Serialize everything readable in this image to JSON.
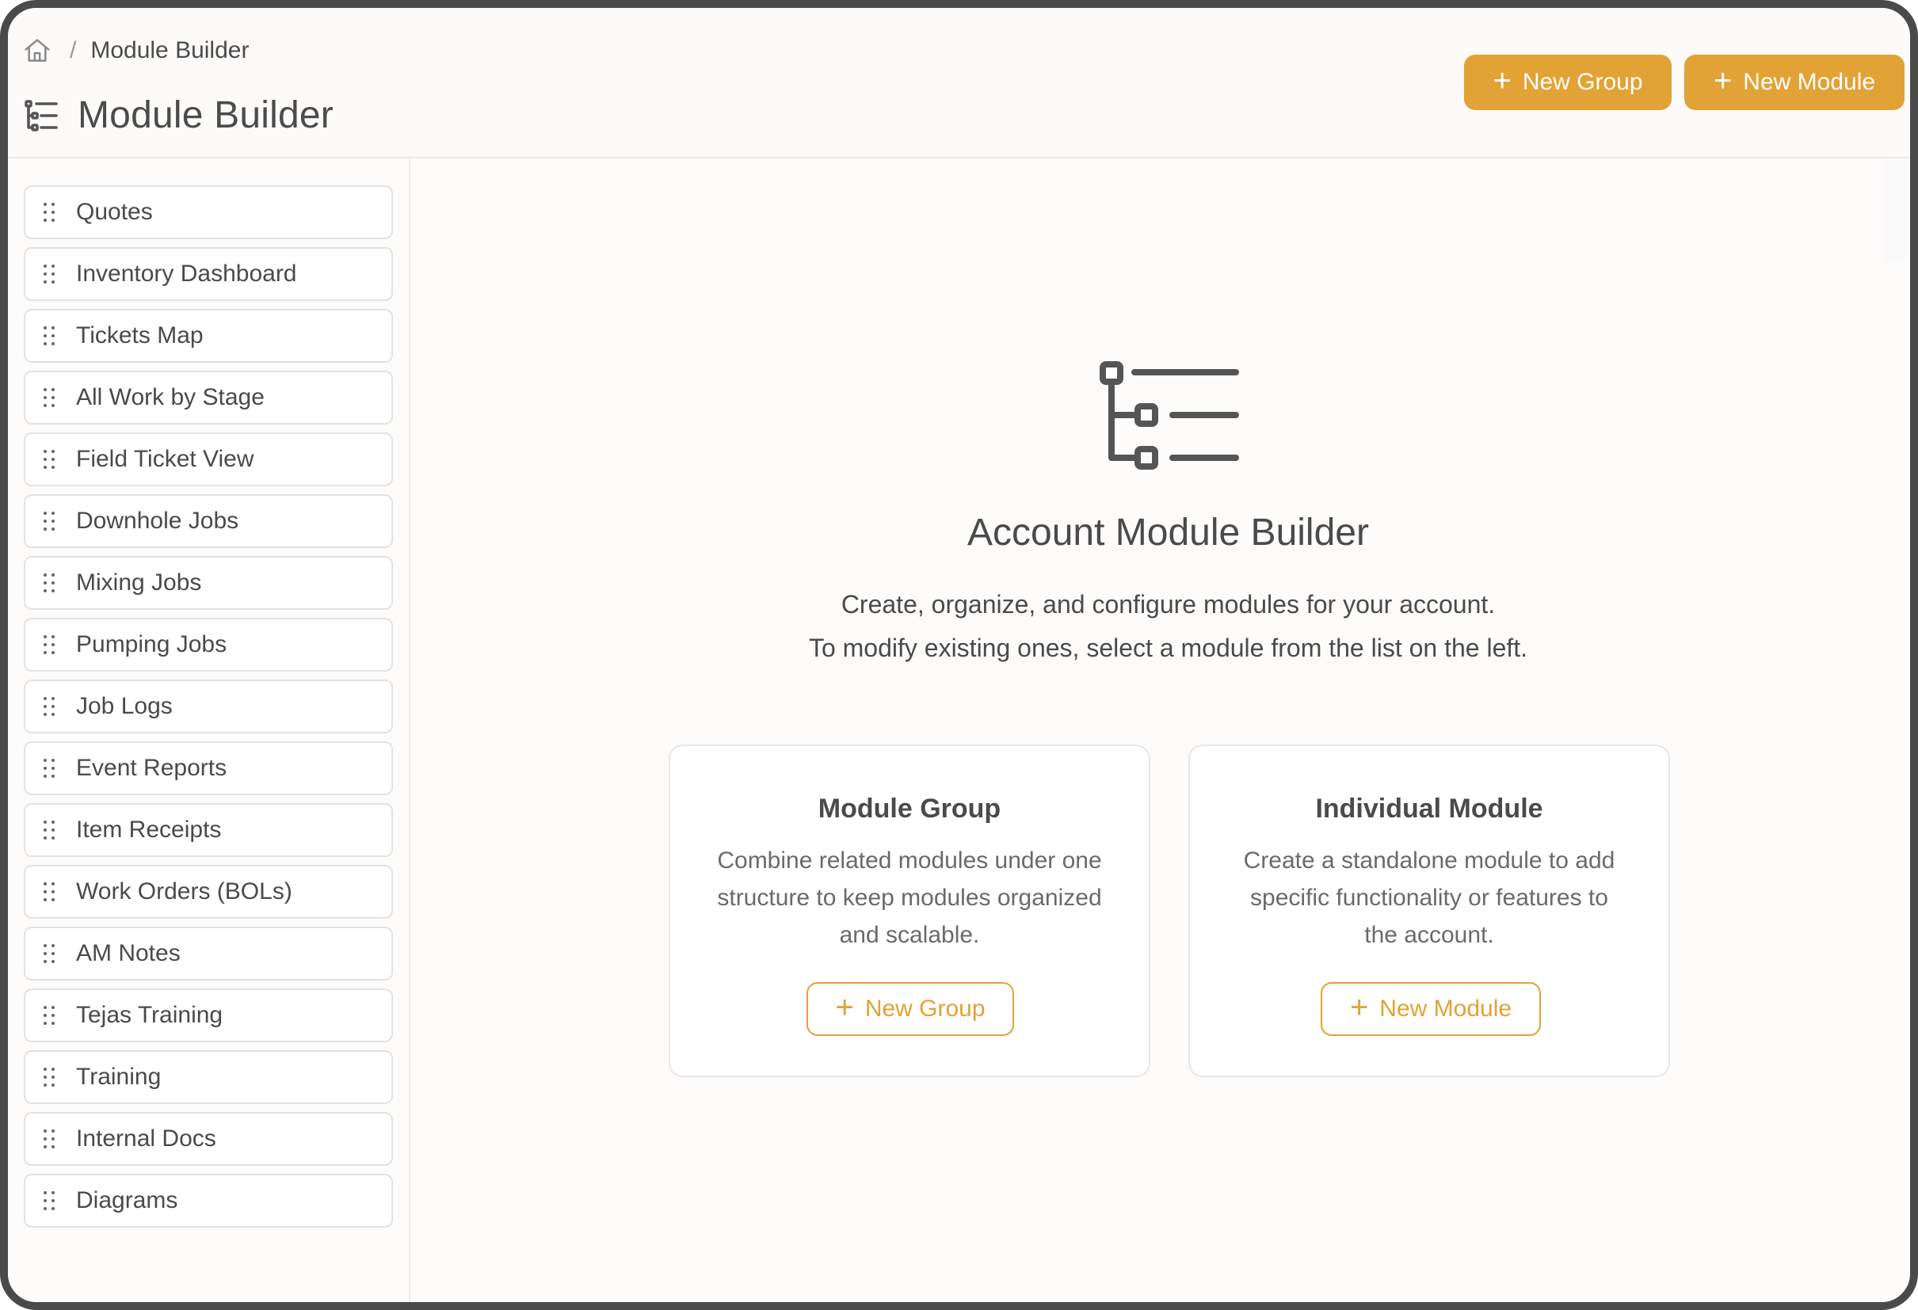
{
  "breadcrumb": {
    "home_icon": "home-icon",
    "separator": "/",
    "current": "Module Builder"
  },
  "header": {
    "title": "Module Builder",
    "title_icon": "module-tree-icon",
    "new_group_label": "New Group",
    "new_module_label": "New Module"
  },
  "colors": {
    "accent": "#e3a235",
    "text": "#4a4a4a",
    "muted": "#6a6a6a",
    "border": "#e3e3e3"
  },
  "sidebar": {
    "items": [
      {
        "label": "Quotes"
      },
      {
        "label": "Inventory Dashboard"
      },
      {
        "label": "Tickets Map"
      },
      {
        "label": "All Work by Stage"
      },
      {
        "label": "Field Ticket View"
      },
      {
        "label": "Downhole Jobs"
      },
      {
        "label": "Mixing Jobs"
      },
      {
        "label": "Pumping Jobs"
      },
      {
        "label": "Job Logs"
      },
      {
        "label": "Event Reports"
      },
      {
        "label": "Item Receipts"
      },
      {
        "label": "Work Orders (BOLs)"
      },
      {
        "label": "AM Notes"
      },
      {
        "label": "Tejas Training"
      },
      {
        "label": "Training"
      },
      {
        "label": "Internal Docs"
      },
      {
        "label": "Diagrams"
      }
    ]
  },
  "main": {
    "hero_title": "Account Module Builder",
    "hero_desc_line1": "Create, organize, and configure modules for your account.",
    "hero_desc_line2": "To modify existing ones, select a module from the list on the left.",
    "cards": [
      {
        "title": "Module Group",
        "desc": [
          "Combine related modules under one",
          "structure to keep modules organized",
          "and scalable."
        ],
        "button": "New Group"
      },
      {
        "title": "Individual Module",
        "desc": [
          "Create a standalone module to add",
          "specific functionality or features to",
          "the account."
        ],
        "button": "New Module"
      }
    ]
  }
}
